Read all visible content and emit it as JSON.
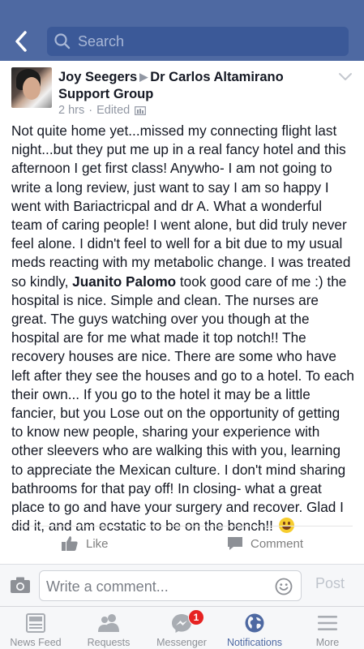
{
  "search": {
    "placeholder": "Search"
  },
  "post": {
    "author": "Joy Seegers",
    "group": "Dr Carlos Altamirano Support Group",
    "time": "2 hrs",
    "edited": "Edited",
    "body_before_mention": "Not quite home yet...missed my connecting flight last night...but they put me up in a real fancy hotel and this afternoon I get first class! Anywho- I am not going to write a long review, just want to say I am so happy I went with Bariactricpal and dr A. What a wonderful team of caring people! I went alone, but did truly never feel alone. I didn't feel to well for a bit due to my usual meds reacting with my metabolic change. I was treated so kindly, ",
    "mention": "Juanito Palomo",
    "body_after_mention": " took good care of me :) the hospital is nice. Simple and clean. The nurses are great. The guys watching over you though at the hospital are for me what made it top notch!! The recovery houses are nice. There are some who have left after they see the houses and go to a hotel. To each their own... If you go to the hotel it may be a little fancier, but you Lose out on the opportunity of getting to know new people, sharing your experience with other sleevers who are walking this with you, learning to appreciate the Mexican culture. I don't mind sharing bathrooms for that pay off! In closing- what a great place to go and have your surgery and recover. Glad I did it, and am ecstatic to be on the bench!! ",
    "emoji": "grinning-face-emoji",
    "actions": {
      "like": "Like",
      "comment": "Comment"
    }
  },
  "composer": {
    "placeholder": "Write a comment...",
    "post_label": "Post"
  },
  "tabs": [
    {
      "label": "News Feed",
      "icon": "news-feed-icon",
      "active": false
    },
    {
      "label": "Requests",
      "icon": "friends-icon",
      "active": false
    },
    {
      "label": "Messenger",
      "icon": "messenger-icon",
      "active": false,
      "badge": "1"
    },
    {
      "label": "Notifications",
      "icon": "globe-icon",
      "active": true
    },
    {
      "label": "More",
      "icon": "menu-icon",
      "active": false
    }
  ],
  "colors": {
    "brand": "#4e69a2",
    "search_bg": "#3b5998",
    "badge": "#e62222",
    "inactive": "#8d9096"
  }
}
